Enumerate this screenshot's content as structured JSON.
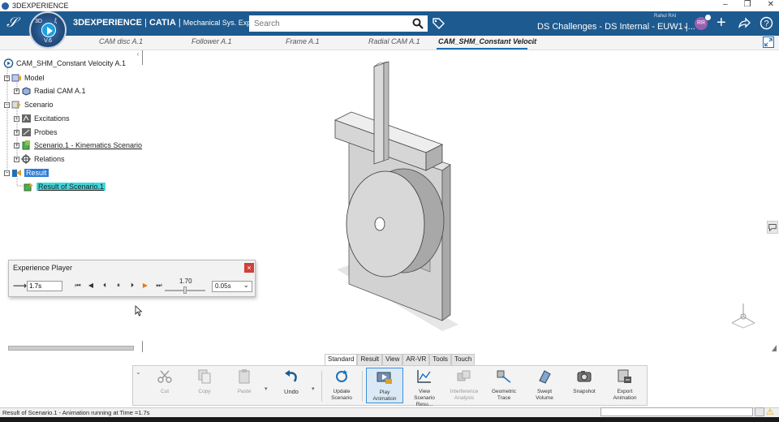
{
  "os": {
    "title": "3DEXPERIENCE",
    "buttons": [
      "–",
      "❐",
      "✕"
    ]
  },
  "topbar": {
    "brand": "3DEXPERIENCE | CATIA",
    "brand_strong": "3DEXPERIENCE",
    "brand_product": "CATIA",
    "app": "Mechanical Sys. Experie...",
    "compass_version": "V.6",
    "compass_3d": "3D",
    "compass_k": "ξ",
    "search_placeholder": "Search",
    "user_name": "Rahul RAI",
    "context": "DS Challenges - DS Internal - EUW1 |...",
    "avatar_initials": "RR"
  },
  "tabs": [
    {
      "label": "CAM disc A.1"
    },
    {
      "label": "Follower A.1"
    },
    {
      "label": "Frame A.1"
    },
    {
      "label": "Radial CAM A.1"
    },
    {
      "label": "CAM_SHM_Constant Velocit"
    }
  ],
  "tree": {
    "collapse": "‹",
    "root": "CAM_SHM_Constant Velocity A.1",
    "model": "Model",
    "radial": "Radial CAM A.1",
    "scenario": "Scenario",
    "excitations": "Excitations",
    "probes": "Probes",
    "kinematics": "Scenario.1 - Kinematics Scenario",
    "relations": "Relations",
    "result": "Result",
    "result_of": "Result of Scenario.1"
  },
  "player": {
    "title": "Experience Player",
    "close": "×",
    "time": "1.7s",
    "value": "1.70",
    "step": "0.05s",
    "controls": [
      "⏮",
      "◀",
      "⏴",
      "⏸",
      "⏵",
      "▶",
      "⏭"
    ]
  },
  "sections": [
    "Standard",
    "Result",
    "View",
    "AR-VR",
    "Tools",
    "Touch"
  ],
  "actions": {
    "cut": "Cut",
    "copy": "Copy",
    "paste": "Paste",
    "undo": "Undo",
    "update": [
      "Update",
      "Scenario"
    ],
    "play": [
      "Play",
      "Animation"
    ],
    "view": [
      "View",
      "Scenario Resu..."
    ],
    "interference": [
      "Interference",
      "Analysis"
    ],
    "trace": [
      "Geometric",
      "Trace"
    ],
    "swept": [
      "Swept",
      "Volume"
    ],
    "snapshot": "Snapshot",
    "export": [
      "Export",
      "Animation"
    ]
  },
  "status": {
    "text": "Result of Scenario.1 - Animation running at Time =1.7s"
  },
  "colors": {
    "topbar": "#1d5a8f",
    "accent": "#1d70b8",
    "highlight": "#3cd8dc",
    "close": "#d0403a"
  }
}
